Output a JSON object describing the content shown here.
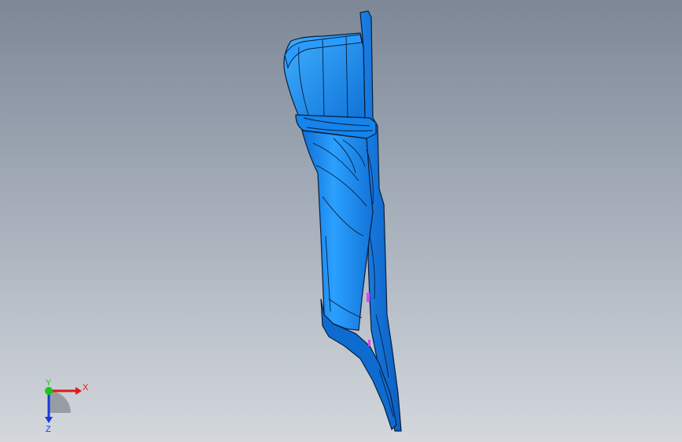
{
  "viewport": {
    "background_top": "#7d8796",
    "background_bottom": "#d4d8dd",
    "model_color": "#1a8cf0",
    "model_edge_color": "#0a1e3c",
    "highlight_color": "#e040ff"
  },
  "triad": {
    "x_label": "X",
    "y_label": "Y",
    "z_label": "Z",
    "x_color": "#e01818",
    "y_color": "#18c818",
    "z_color": "#1838e0"
  }
}
